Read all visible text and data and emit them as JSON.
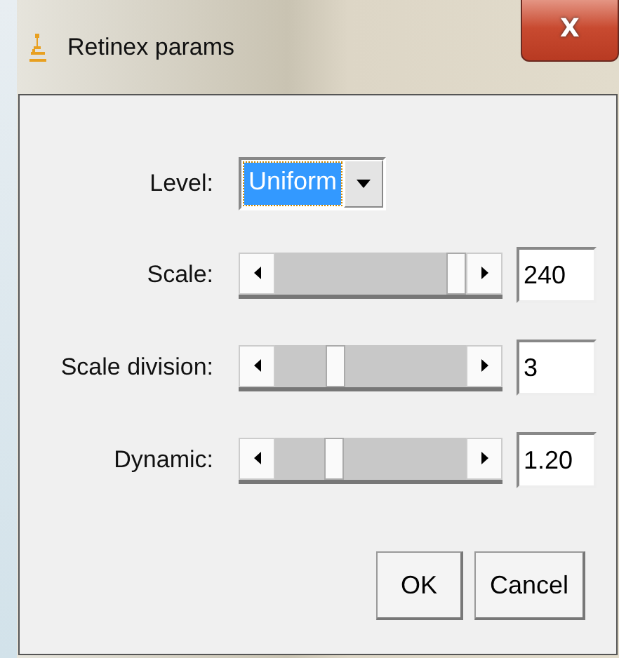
{
  "window": {
    "title": "Retinex params",
    "close_label": "X"
  },
  "level_field": {
    "label": "Level:",
    "value": "Uniform"
  },
  "sliders": [
    {
      "label": "Scale:",
      "value": "240"
    },
    {
      "label": "Scale division:",
      "value": "3"
    },
    {
      "label": "Dynamic:",
      "value": "1.20"
    }
  ],
  "buttons": [
    "OK",
    "Cancel"
  ]
}
